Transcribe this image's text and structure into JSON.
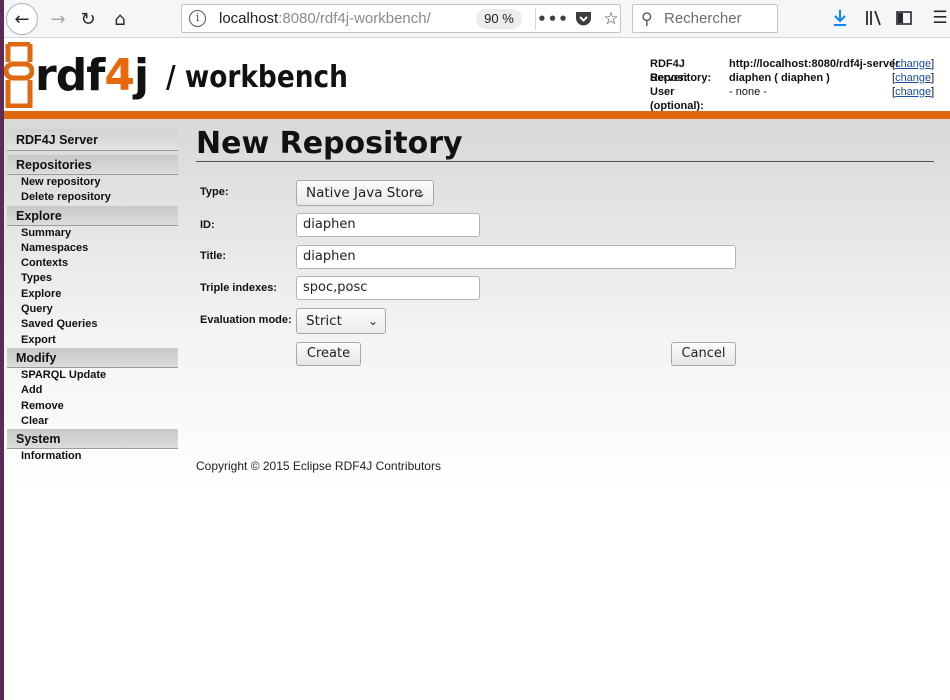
{
  "browser": {
    "url_host": "localhost",
    "url_path": ":8080/rdf4j-workbench/",
    "zoom": "90 %",
    "search_placeholder": "Rechercher"
  },
  "header": {
    "logo_rdf": "rdf",
    "logo_four": "4",
    "logo_j": "j",
    "logo_sub": "/ workbench",
    "server_label": "RDF4J Server:",
    "server_value": "http://localhost:8080/rdf4j-server",
    "repository_label": "Repository:",
    "repository_value": "diaphen ( diaphen )",
    "user_label": "User (optional):",
    "user_value": "- none -",
    "change_label": "change"
  },
  "nav": {
    "server": "RDF4J Server",
    "repositories": {
      "title": "Repositories",
      "items": [
        "New repository",
        "Delete repository"
      ]
    },
    "explore": {
      "title": "Explore",
      "items": [
        "Summary",
        "Namespaces",
        "Contexts",
        "Types",
        "Explore",
        "Query",
        "Saved Queries",
        "Export"
      ]
    },
    "modify": {
      "title": "Modify",
      "items": [
        "SPARQL Update",
        "Add",
        "Remove",
        "Clear"
      ]
    },
    "system": {
      "title": "System",
      "items": [
        "Information"
      ]
    }
  },
  "main": {
    "title": "New Repository",
    "type_label": "Type:",
    "type_value": "Native Java Store",
    "id_label": "ID:",
    "id_value": "diaphen",
    "title_label": "Title:",
    "title_value": "diaphen",
    "indexes_label": "Triple indexes:",
    "indexes_value": "spoc,posc",
    "eval_label": "Evaluation mode:",
    "eval_value": "Strict",
    "create_label": "Create",
    "cancel_label": "Cancel"
  },
  "footer": {
    "copyright": "Copyright © 2015 Eclipse RDF4J Contributors"
  },
  "colors": {
    "accent_orange": "#e0680f",
    "left_strip": "#5b2a55",
    "link_blue": "#1a4c9c"
  }
}
